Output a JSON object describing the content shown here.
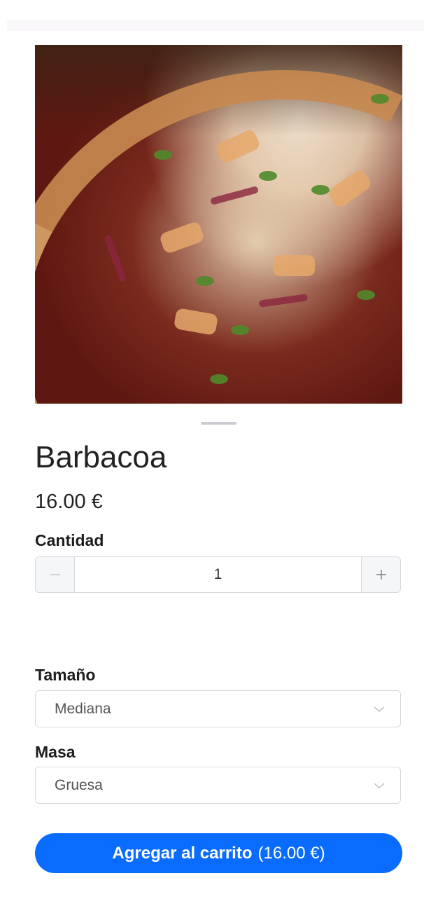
{
  "product": {
    "name": "Barbacoa",
    "price": "16.00 €"
  },
  "quantity": {
    "label": "Cantidad",
    "value": "1",
    "minus_icon": "minus-icon",
    "plus_icon": "plus-icon"
  },
  "size": {
    "label": "Tamaño",
    "selected": "Mediana"
  },
  "dough": {
    "label": "Masa",
    "selected": "Gruesa"
  },
  "cta": {
    "label": "Agregar al carrito",
    "total": "(16.00 €)"
  },
  "colors": {
    "accent": "#0a6cff",
    "border": "#d6d9de",
    "stepper_bg": "#f5f6f8"
  }
}
